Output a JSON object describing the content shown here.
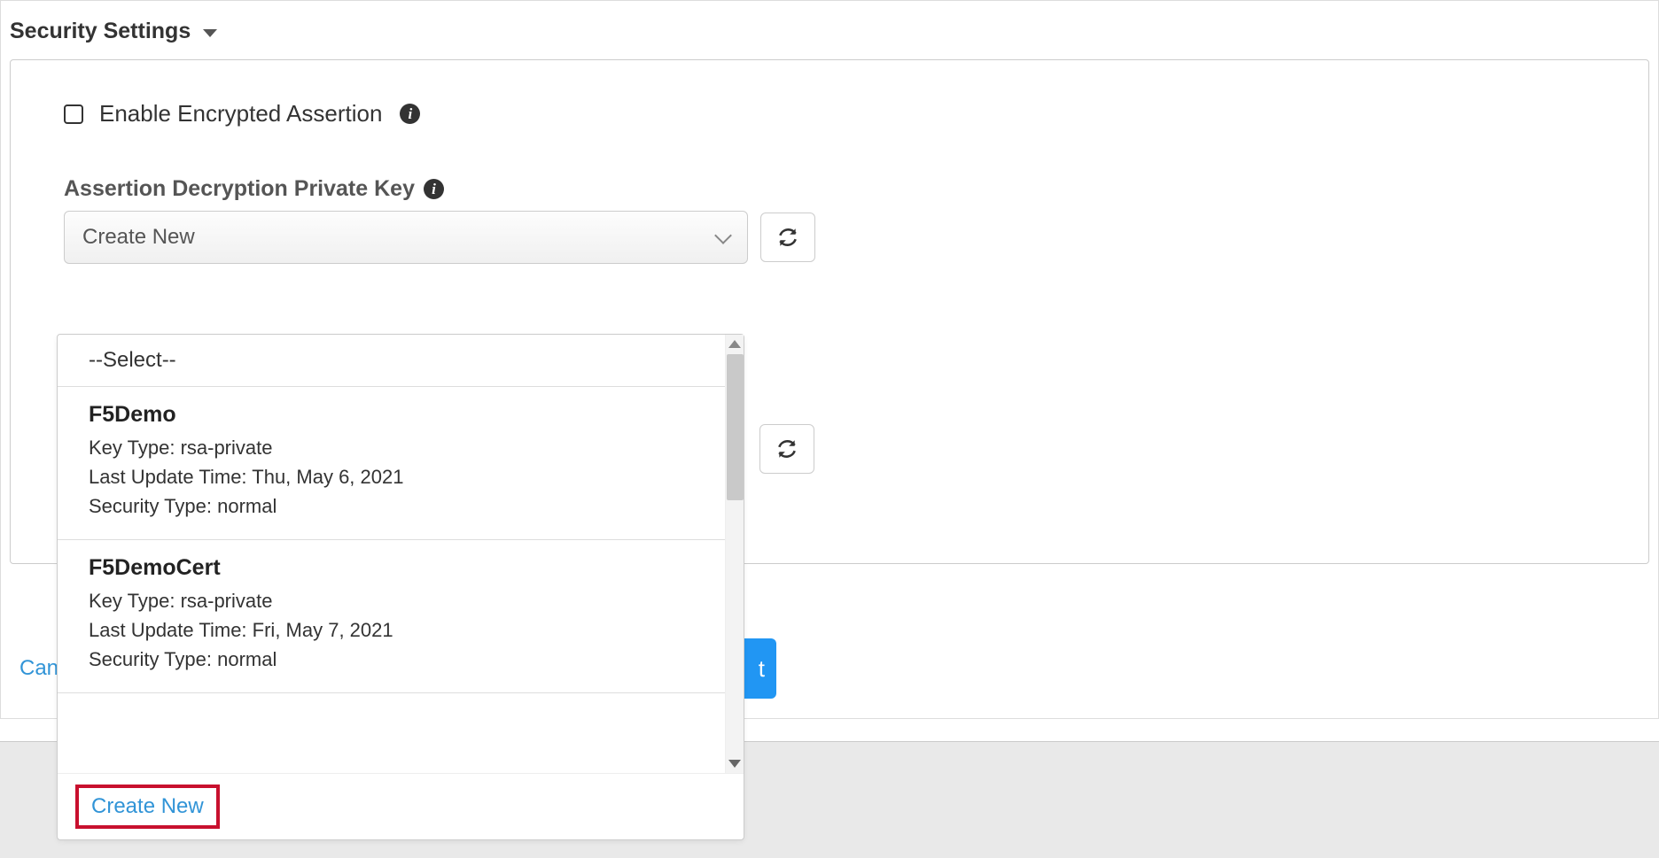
{
  "section": {
    "title": "Security Settings"
  },
  "checkbox": {
    "label": "Enable Encrypted Assertion"
  },
  "private_key": {
    "label": "Assertion Decryption Private Key",
    "select_value": "Create New"
  },
  "dropdown": {
    "placeholder": "--Select--",
    "items": [
      {
        "name": "F5Demo",
        "key_type_label": "Key Type:",
        "key_type_value": "rsa-private",
        "last_update_label": "Last Update Time:",
        "last_update_value": "Thu, May 6, 2021",
        "security_type_label": "Security Type:",
        "security_type_value": "normal"
      },
      {
        "name": "F5DemoCert",
        "key_type_label": "Key Type:",
        "key_type_value": "rsa-private",
        "last_update_label": "Last Update Time:",
        "last_update_value": "Fri, May 7, 2021",
        "security_type_label": "Security Type:",
        "security_type_value": "normal"
      }
    ],
    "create_new": "Create New"
  },
  "footer": {
    "cancel": "Can",
    "next_fragment": "t"
  }
}
